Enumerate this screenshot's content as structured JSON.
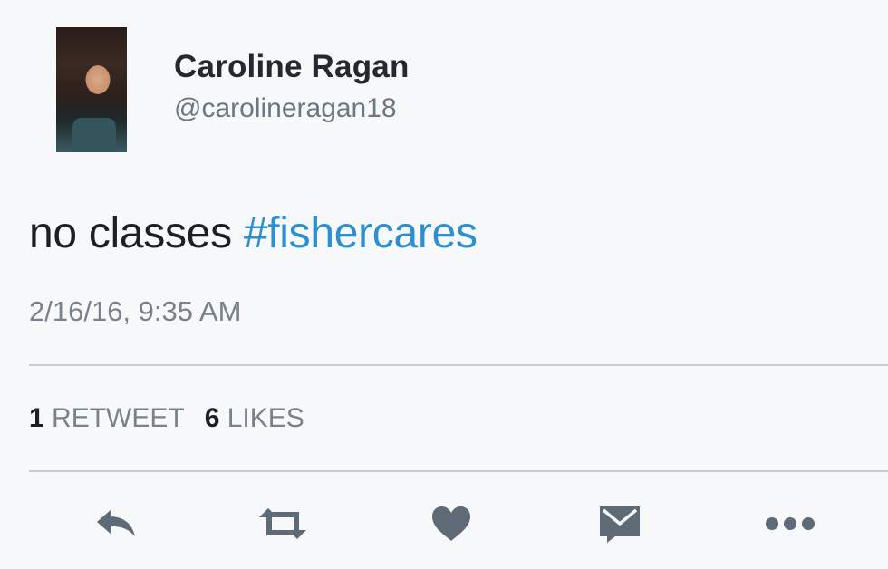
{
  "tweet": {
    "display_name": "Caroline Ragan",
    "handle": "@carolineragan18",
    "text_plain": "no classes ",
    "hashtag": "#fishercares",
    "timestamp": "2/16/16, 9:35 AM",
    "retweet_count": "1",
    "retweet_label": "RETWEET",
    "like_count": "6",
    "like_label": "LIKES"
  },
  "actions": {
    "reply_icon": "reply-icon",
    "retweet_icon": "retweet-icon",
    "like_icon": "heart-icon",
    "dm_icon": "envelope-icon",
    "more_icon": "more-dots-icon"
  },
  "colors": {
    "hashtag": "#2b8fd0",
    "icon": "#5e6a75",
    "muted_text": "#79828b",
    "divider": "#c7ccd2"
  }
}
